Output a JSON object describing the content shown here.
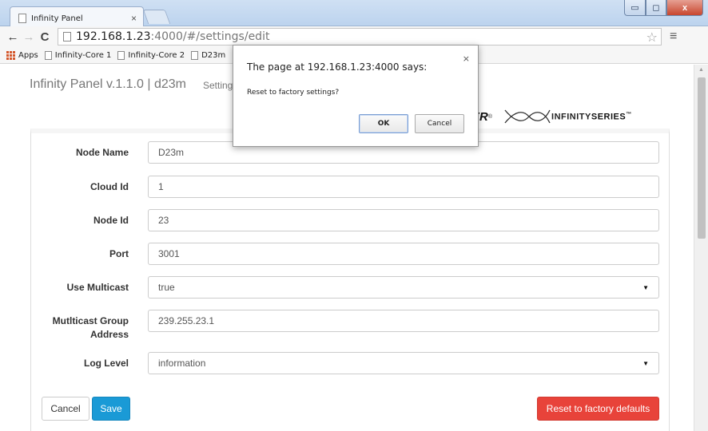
{
  "browser": {
    "tab_title": "Infinity Panel",
    "tab_close": "×",
    "url_host": "192.168.1.23",
    "url_path": ":4000/#/settings/edit",
    "bookmarks": [
      {
        "label": "Apps"
      },
      {
        "label": "Infinity-Core 1"
      },
      {
        "label": "Infinity-Core 2"
      },
      {
        "label": "D23m"
      }
    ],
    "window_buttons": {
      "minimize": "▭",
      "maximize": "◻",
      "close": "x"
    }
  },
  "header": {
    "brand": "Infinity Panel v.1.1.0 | d23m",
    "nav_settings": "Settings",
    "logo_er": "ER",
    "logo_registered": "®",
    "logo_infinity": "INFINITY",
    "logo_series": "SERIES",
    "logo_tm": "™"
  },
  "form": {
    "fields": [
      {
        "label": "Node Name",
        "value": "D23m"
      },
      {
        "label": "Cloud Id",
        "value": "1"
      },
      {
        "label": "Node Id",
        "value": "23"
      },
      {
        "label": "Port",
        "value": "3001"
      },
      {
        "label": "Use Multicast",
        "value": "true"
      },
      {
        "label_line1": "Mutlticast Group",
        "label_line2": "Address",
        "value": "239.255.23.1"
      },
      {
        "label": "Log Level",
        "value": "information"
      }
    ],
    "cancel_label": "Cancel",
    "save_label": "Save",
    "reset_label": "Reset to factory defaults"
  },
  "dialog": {
    "title": "The page at 192.168.1.23:4000 says:",
    "message": "Reset to factory settings?",
    "ok_label": "OK",
    "cancel_label": "Cancel",
    "close": "×"
  },
  "colors": {
    "save": "#1a9ad6",
    "reset": "#e8433a"
  }
}
